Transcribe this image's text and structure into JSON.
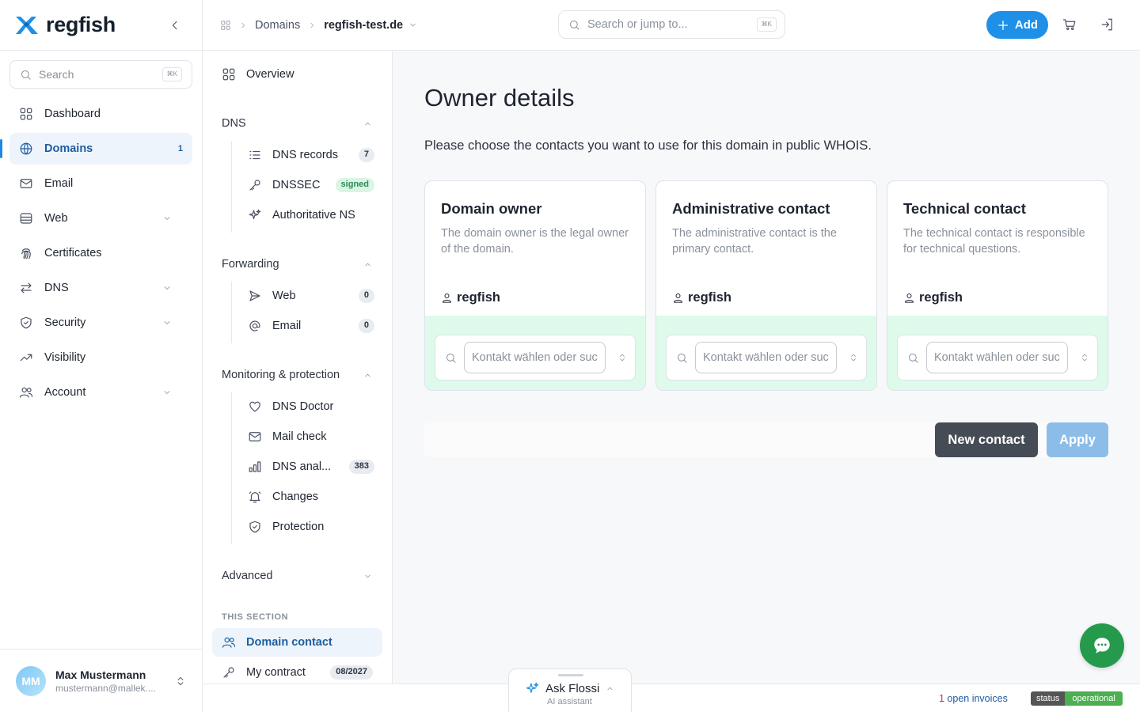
{
  "brand": {
    "name": "regfish"
  },
  "sidebar": {
    "search_placeholder": "Search",
    "search_kbd": "⌘K",
    "items": [
      {
        "label": "Dashboard",
        "icon": "grid-icon"
      },
      {
        "label": "Domains",
        "icon": "globe-icon",
        "count": "1",
        "active": true
      },
      {
        "label": "Email",
        "icon": "mail-icon"
      },
      {
        "label": "Web",
        "icon": "server-icon",
        "expandable": true
      },
      {
        "label": "Certificates",
        "icon": "fingerprint-icon"
      },
      {
        "label": "DNS",
        "icon": "arrows-icon",
        "expandable": true
      },
      {
        "label": "Security",
        "icon": "shield-icon",
        "expandable": true
      },
      {
        "label": "Visibility",
        "icon": "trend-icon"
      },
      {
        "label": "Account",
        "icon": "users-icon",
        "expandable": true
      }
    ],
    "user": {
      "initials": "MM",
      "name": "Max Mustermann",
      "email": "mustermann@mallek...."
    }
  },
  "topbar": {
    "breadcrumb": {
      "parent": "Domains",
      "current": "regfish-test.de"
    },
    "search_placeholder": "Search or jump to...",
    "search_kbd": "⌘K",
    "add_label": "Add"
  },
  "subnav": {
    "overview": "Overview",
    "dns": {
      "heading": "DNS",
      "items": [
        {
          "label": "DNS records",
          "badge": "7"
        },
        {
          "label": "DNSSEC",
          "badge": "signed"
        },
        {
          "label": "Authoritative NS"
        }
      ]
    },
    "forwarding": {
      "heading": "Forwarding",
      "items": [
        {
          "label": "Web",
          "badge": "0"
        },
        {
          "label": "Email",
          "badge": "0"
        }
      ]
    },
    "monitoring": {
      "heading": "Monitoring & protection",
      "items": [
        {
          "label": "DNS Doctor"
        },
        {
          "label": "Mail check"
        },
        {
          "label": "DNS anal...",
          "badge": "383"
        },
        {
          "label": "Changes"
        },
        {
          "label": "Protection"
        }
      ]
    },
    "advanced": "Advanced",
    "section_label": "THIS SECTION",
    "section_items": [
      {
        "label": "Domain contact",
        "active": true
      },
      {
        "label": "My contract",
        "badge": "08/2027"
      }
    ]
  },
  "main": {
    "title": "Owner details",
    "description": "Please choose the contacts you want to use for this domain in public WHOIS.",
    "cards": [
      {
        "title": "Domain owner",
        "desc": "The domain owner is the legal owner of the domain.",
        "contact": "regfish",
        "placeholder": "Kontakt wählen oder suchen"
      },
      {
        "title": "Administrative contact",
        "desc": "The administrative contact is the primary contact.",
        "contact": "regfish",
        "placeholder": "Kontakt wählen oder suchen"
      },
      {
        "title": "Technical contact",
        "desc": "The technical contact is responsible for technical questions.",
        "contact": "regfish",
        "placeholder": "Kontakt wählen oder suchen"
      }
    ],
    "new_contact_label": "New contact",
    "apply_label": "Apply"
  },
  "footer": {
    "invoice_count": "1",
    "invoice_text": " open invoices",
    "status_key": "status",
    "status_value": "operational"
  },
  "assistant": {
    "title": "Ask Flossi",
    "subtitle": "AI assistant"
  },
  "colors": {
    "accent": "#1e90e8",
    "active_bg": "#eef4fb",
    "card_footer": "#defaea",
    "chat": "#259a4c"
  }
}
